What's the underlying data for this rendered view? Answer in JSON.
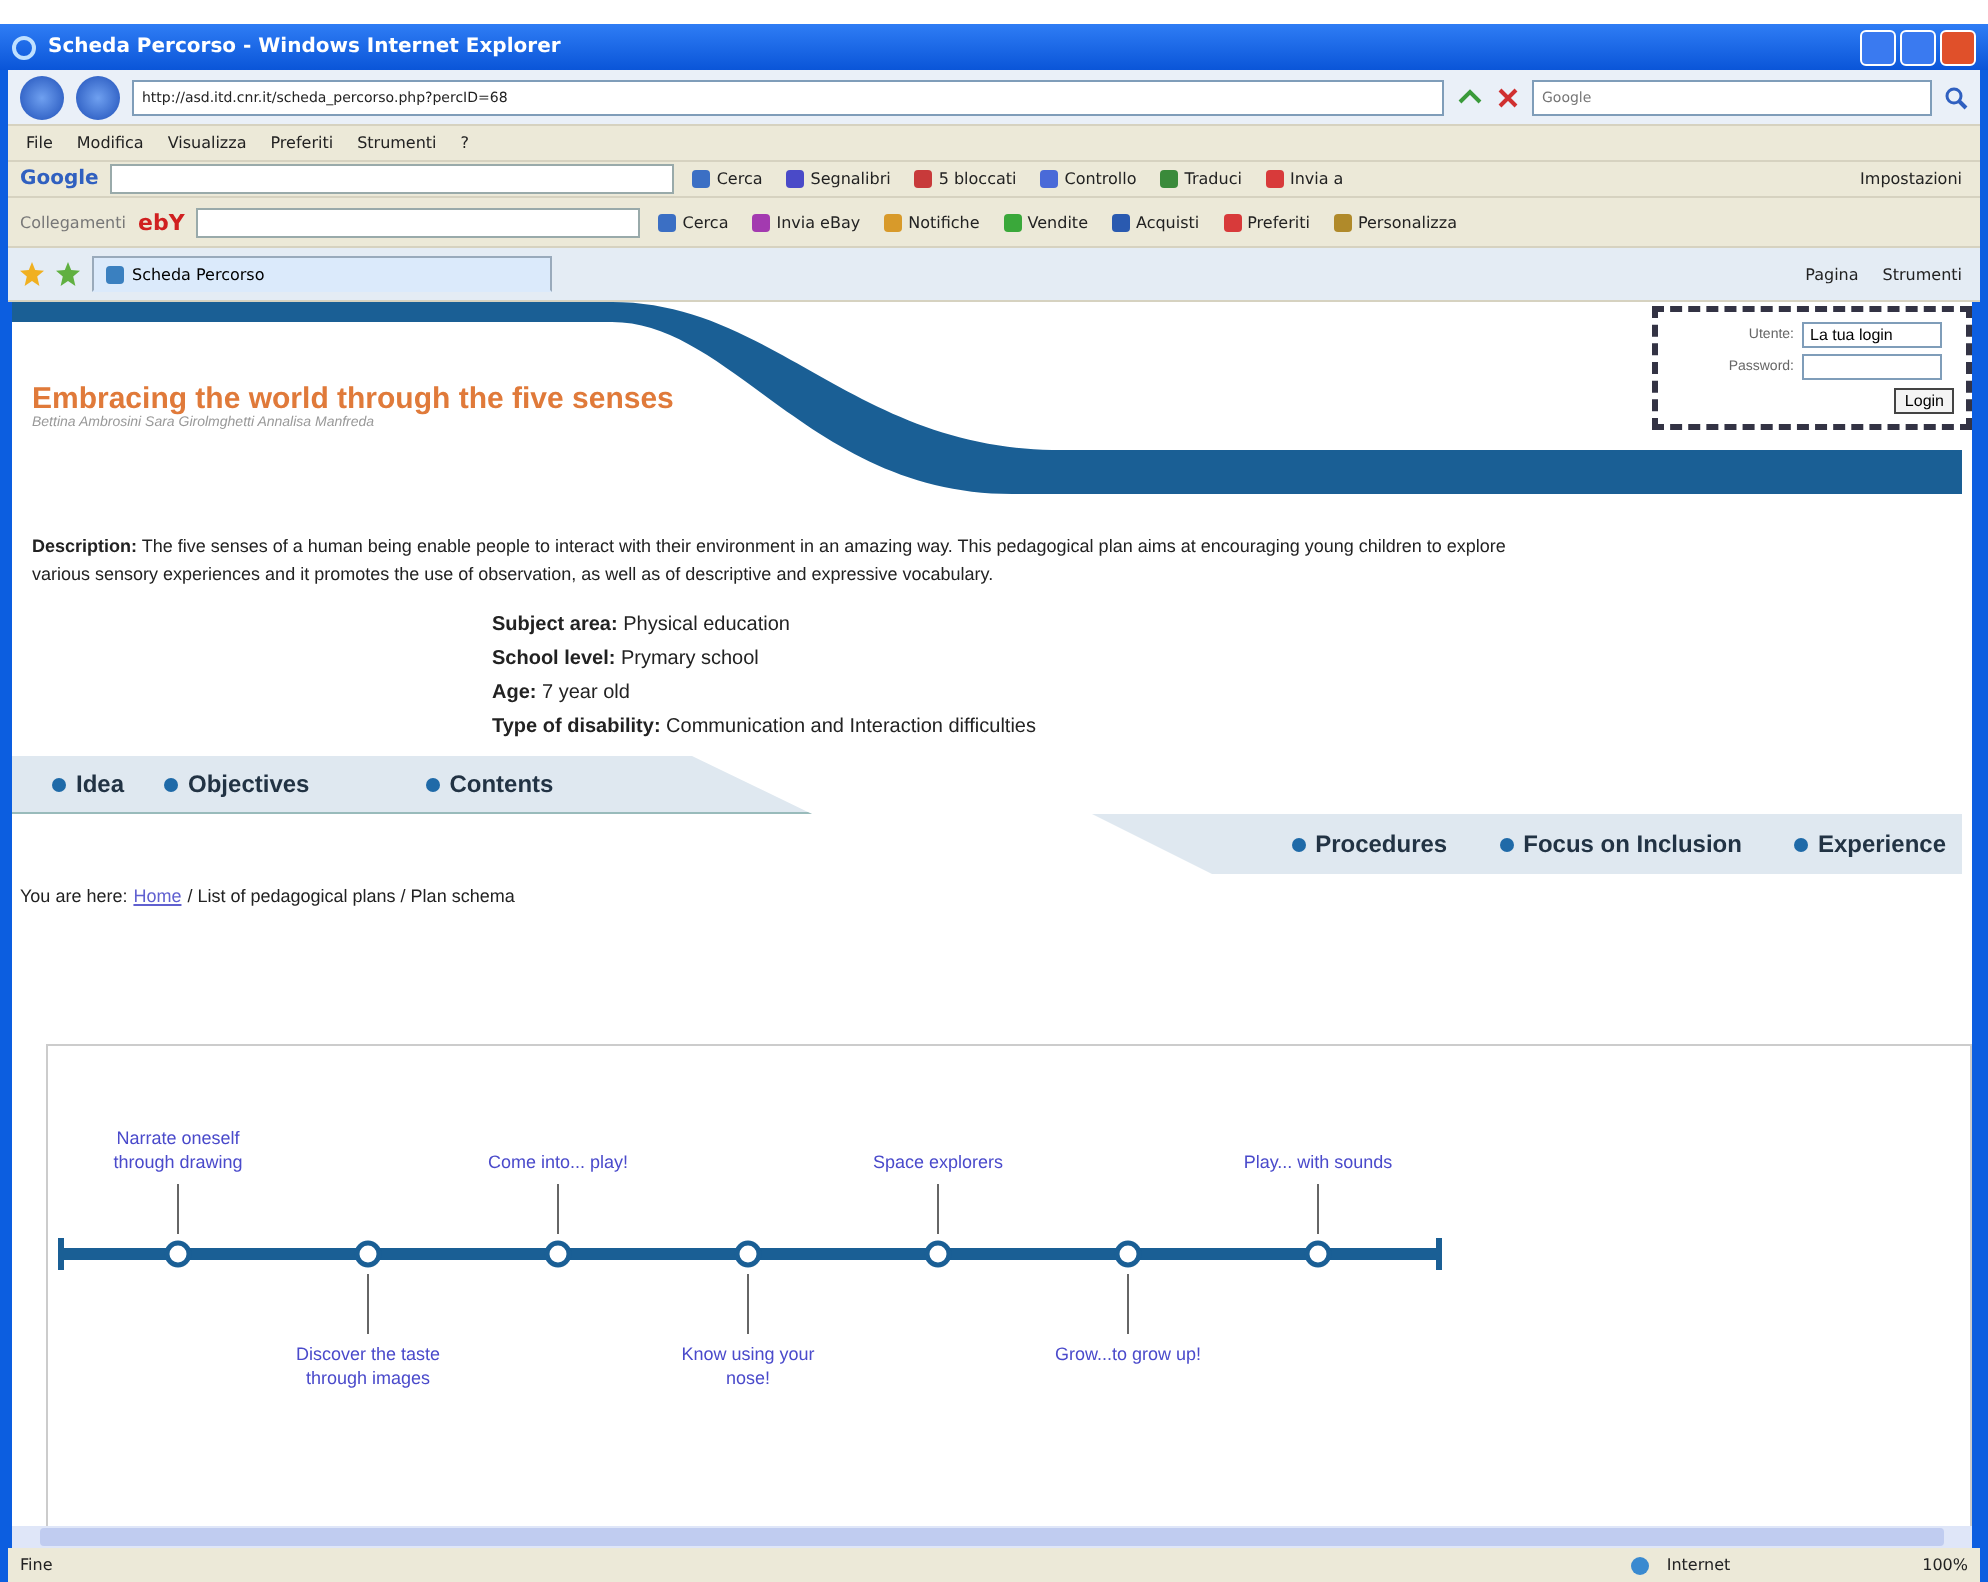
{
  "window": {
    "title": "Scheda Percorso - Windows Internet Explorer"
  },
  "address_bar": {
    "url": "http://asd.itd.cnr.it/scheda_percorso.php?percID=68",
    "search_placeholder": "Google"
  },
  "menu_bar": [
    "File",
    "Modifica",
    "Visualizza",
    "Preferiti",
    "Strumenti",
    "?"
  ],
  "google_toolbar": {
    "logo": "Google",
    "items": [
      {
        "label": "Cerca",
        "color": "#3b6fc4"
      },
      {
        "label": "Segnalibri",
        "color": "#4a4ac8"
      },
      {
        "label": "5 bloccati",
        "color": "#c83a3a"
      },
      {
        "label": "Controllo",
        "color": "#4a6ad8"
      },
      {
        "label": "Traduci",
        "color": "#3a8a3a"
      },
      {
        "label": "Invia a",
        "color": "#d83a3a"
      }
    ],
    "settings": "Impostazioni"
  },
  "ebay_toolbar": {
    "links_label": "Collegamenti",
    "logo": "ebY",
    "items": [
      {
        "label": "Cerca",
        "color": "#3b6fc4"
      },
      {
        "label": "Invia eBay",
        "color": "#a33ab0"
      },
      {
        "label": "Notifiche",
        "color": "#d89a2a"
      },
      {
        "label": "Vendite",
        "color": "#3aa83a"
      },
      {
        "label": "Acquisti",
        "color": "#2a5ab0"
      },
      {
        "label": "Preferiti",
        "color": "#d83a3a"
      },
      {
        "label": "Personalizza",
        "color": "#b08a2a"
      }
    ]
  },
  "tabs": [
    {
      "label": "Scheda Percorso",
      "selected": true
    }
  ],
  "command_bar": [
    "Pagina",
    "Strumenti"
  ],
  "page": {
    "login": {
      "user_label": "Utente:",
      "user_value": "La tua login",
      "password_label": "Password:",
      "button": "Login"
    },
    "title": "Embracing the world through the five senses",
    "authors": "Bettina Ambrosini Sara Girolmghetti Annalisa Manfreda",
    "description": "**Description:** The five senses of a human being enable people to interact with their environment in an amazing way. This pedagogical plan aims at encouraging young children to explore various sensory experiences and it promotes the use of observation, as well as of descriptive and expressive vocabulary.",
    "details": [
      "**Subject area:** Physical education",
      "**School level:** Prymary school",
      "**Age:** 7 year old",
      "**Type of disability:** Communication and Interaction difficulties"
    ],
    "nav_top": [
      "Idea",
      "Objectives",
      "Contents"
    ],
    "nav_bottom": [
      "Procedures",
      "Focus on Inclusion",
      "Experience"
    ],
    "breadcrumb": {
      "prefix": "You are here:",
      "link": "Home",
      "rest": "/ List of pedagogical plans / Plan schema"
    },
    "timeline": [
      {
        "label": "Narrate oneself through drawing",
        "kind": "above"
      },
      {
        "label": "Discover the taste through images",
        "kind": "below"
      },
      {
        "label": "Come into... play!",
        "kind": "above"
      },
      {
        "label": "Know using your nose!",
        "kind": "below"
      },
      {
        "label": "Space explorers",
        "kind": "above"
      },
      {
        "label": "Grow...to grow up!",
        "kind": "below"
      },
      {
        "label": "Play... with sounds",
        "kind": "above"
      }
    ]
  },
  "status_bar": {
    "text": "Fine",
    "zone": "Internet",
    "zoom": "100%"
  }
}
